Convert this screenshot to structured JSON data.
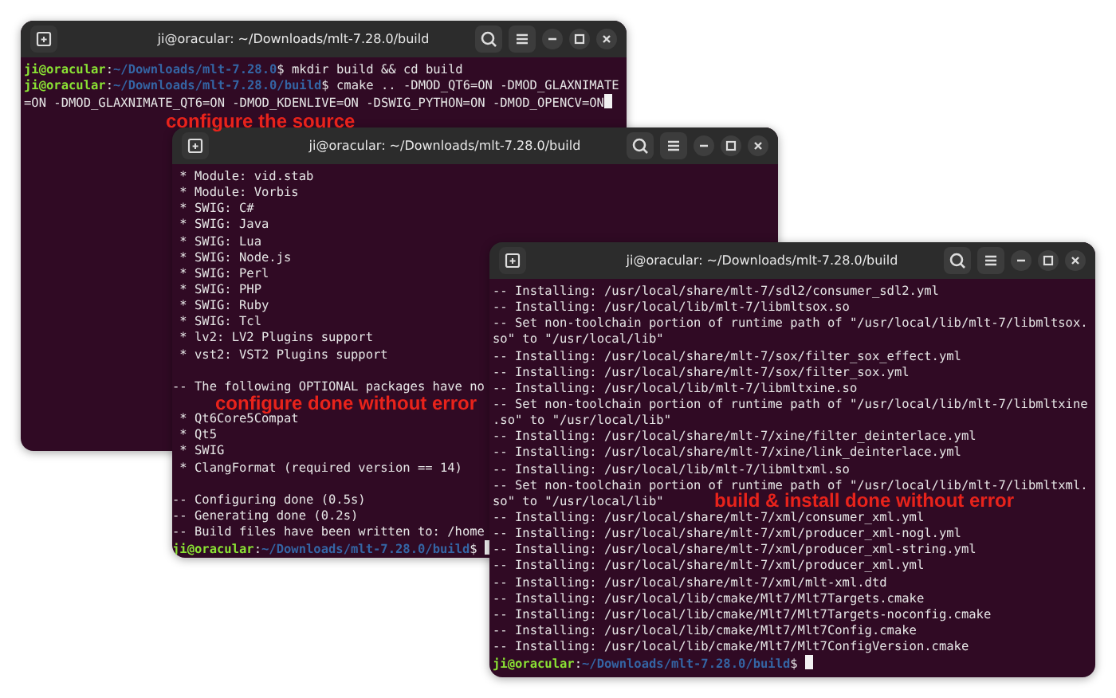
{
  "windows": [
    {
      "title": "ji@oracular: ~/Downloads/mlt-7.28.0/build",
      "lines": [
        {
          "kind": "prompt",
          "user": "ji@oracular",
          "separator": ":",
          "path": "~/Downloads/mlt-7.28.0",
          "symbol": "$",
          "command": "mkdir build && cd build"
        },
        {
          "kind": "prompt",
          "user": "ji@oracular",
          "separator": ":",
          "path": "~/Downloads/mlt-7.28.0/build",
          "symbol": "$",
          "command": "cmake .. -DMOD_QT6=ON -DMOD_GLAXNIMATE"
        },
        {
          "kind": "output",
          "text": "=ON -DMOD_GLAXNIMATE_QT6=ON -DMOD_KDENLIVE=ON -DSWIG_PYTHON=ON -DMOD_OPENCV=ON",
          "cursor": true
        }
      ]
    },
    {
      "title": "ji@oracular: ~/Downloads/mlt-7.28.0/build",
      "lines": [
        {
          "kind": "output",
          "text": " * Module: vid.stab"
        },
        {
          "kind": "output",
          "text": " * Module: Vorbis"
        },
        {
          "kind": "output",
          "text": " * SWIG: C#"
        },
        {
          "kind": "output",
          "text": " * SWIG: Java"
        },
        {
          "kind": "output",
          "text": " * SWIG: Lua"
        },
        {
          "kind": "output",
          "text": " * SWIG: Node.js"
        },
        {
          "kind": "output",
          "text": " * SWIG: Perl"
        },
        {
          "kind": "output",
          "text": " * SWIG: PHP"
        },
        {
          "kind": "output",
          "text": " * SWIG: Ruby"
        },
        {
          "kind": "output",
          "text": " * SWIG: Tcl"
        },
        {
          "kind": "output",
          "text": " * lv2: LV2 Plugins support"
        },
        {
          "kind": "output",
          "text": " * vst2: VST2 Plugins support"
        },
        {
          "kind": "blank"
        },
        {
          "kind": "output",
          "text": "-- The following OPTIONAL packages have no"
        },
        {
          "kind": "blank"
        },
        {
          "kind": "output",
          "text": " * Qt6Core5Compat"
        },
        {
          "kind": "output",
          "text": " * Qt5"
        },
        {
          "kind": "output",
          "text": " * SWIG"
        },
        {
          "kind": "output",
          "text": " * ClangFormat (required version == 14)"
        },
        {
          "kind": "blank"
        },
        {
          "kind": "output",
          "text": "-- Configuring done (0.5s)"
        },
        {
          "kind": "output",
          "text": "-- Generating done (0.2s)"
        },
        {
          "kind": "output",
          "text": "-- Build files have been written to: /home"
        },
        {
          "kind": "prompt",
          "user": "ji@oracular",
          "separator": ":",
          "path": "~/Downloads/mlt-7.28.0/build",
          "symbol": "$",
          "cursor": true
        }
      ]
    },
    {
      "title": "ji@oracular: ~/Downloads/mlt-7.28.0/build",
      "lines": [
        {
          "kind": "output",
          "text": "-- Installing: /usr/local/share/mlt-7/sdl2/consumer_sdl2.yml"
        },
        {
          "kind": "output",
          "text": "-- Installing: /usr/local/lib/mlt-7/libmltsox.so"
        },
        {
          "kind": "output",
          "text": "-- Set non-toolchain portion of runtime path of \"/usr/local/lib/mlt-7/libmltsox."
        },
        {
          "kind": "output",
          "text": "so\" to \"/usr/local/lib\""
        },
        {
          "kind": "output",
          "text": "-- Installing: /usr/local/share/mlt-7/sox/filter_sox_effect.yml"
        },
        {
          "kind": "output",
          "text": "-- Installing: /usr/local/share/mlt-7/sox/filter_sox.yml"
        },
        {
          "kind": "output",
          "text": "-- Installing: /usr/local/lib/mlt-7/libmltxine.so"
        },
        {
          "kind": "output",
          "text": "-- Set non-toolchain portion of runtime path of \"/usr/local/lib/mlt-7/libmltxine"
        },
        {
          "kind": "output",
          "text": ".so\" to \"/usr/local/lib\""
        },
        {
          "kind": "output",
          "text": "-- Installing: /usr/local/share/mlt-7/xine/filter_deinterlace.yml"
        },
        {
          "kind": "output",
          "text": "-- Installing: /usr/local/share/mlt-7/xine/link_deinterlace.yml"
        },
        {
          "kind": "output",
          "text": "-- Installing: /usr/local/lib/mlt-7/libmltxml.so"
        },
        {
          "kind": "output",
          "text": "-- Set non-toolchain portion of runtime path of \"/usr/local/lib/mlt-7/libmltxml."
        },
        {
          "kind": "output",
          "text": "so\" to \"/usr/local/lib\""
        },
        {
          "kind": "output",
          "text": "-- Installing: /usr/local/share/mlt-7/xml/consumer_xml.yml"
        },
        {
          "kind": "output",
          "text": "-- Installing: /usr/local/share/mlt-7/xml/producer_xml-nogl.yml"
        },
        {
          "kind": "output",
          "text": "-- Installing: /usr/local/share/mlt-7/xml/producer_xml-string.yml"
        },
        {
          "kind": "output",
          "text": "-- Installing: /usr/local/share/mlt-7/xml/producer_xml.yml"
        },
        {
          "kind": "output",
          "text": "-- Installing: /usr/local/share/mlt-7/xml/mlt-xml.dtd"
        },
        {
          "kind": "output",
          "text": "-- Installing: /usr/local/lib/cmake/Mlt7/Mlt7Targets.cmake"
        },
        {
          "kind": "output",
          "text": "-- Installing: /usr/local/lib/cmake/Mlt7/Mlt7Targets-noconfig.cmake"
        },
        {
          "kind": "output",
          "text": "-- Installing: /usr/local/lib/cmake/Mlt7/Mlt7Config.cmake"
        },
        {
          "kind": "output",
          "text": "-- Installing: /usr/local/lib/cmake/Mlt7/Mlt7ConfigVersion.cmake"
        },
        {
          "kind": "prompt",
          "user": "ji@oracular",
          "separator": ":",
          "path": "~/Downloads/mlt-7.28.0/build",
          "symbol": "$",
          "cursor": true
        }
      ]
    }
  ],
  "annotations": [
    "configure the source",
    "configure done without error",
    "build & install done without error"
  ]
}
